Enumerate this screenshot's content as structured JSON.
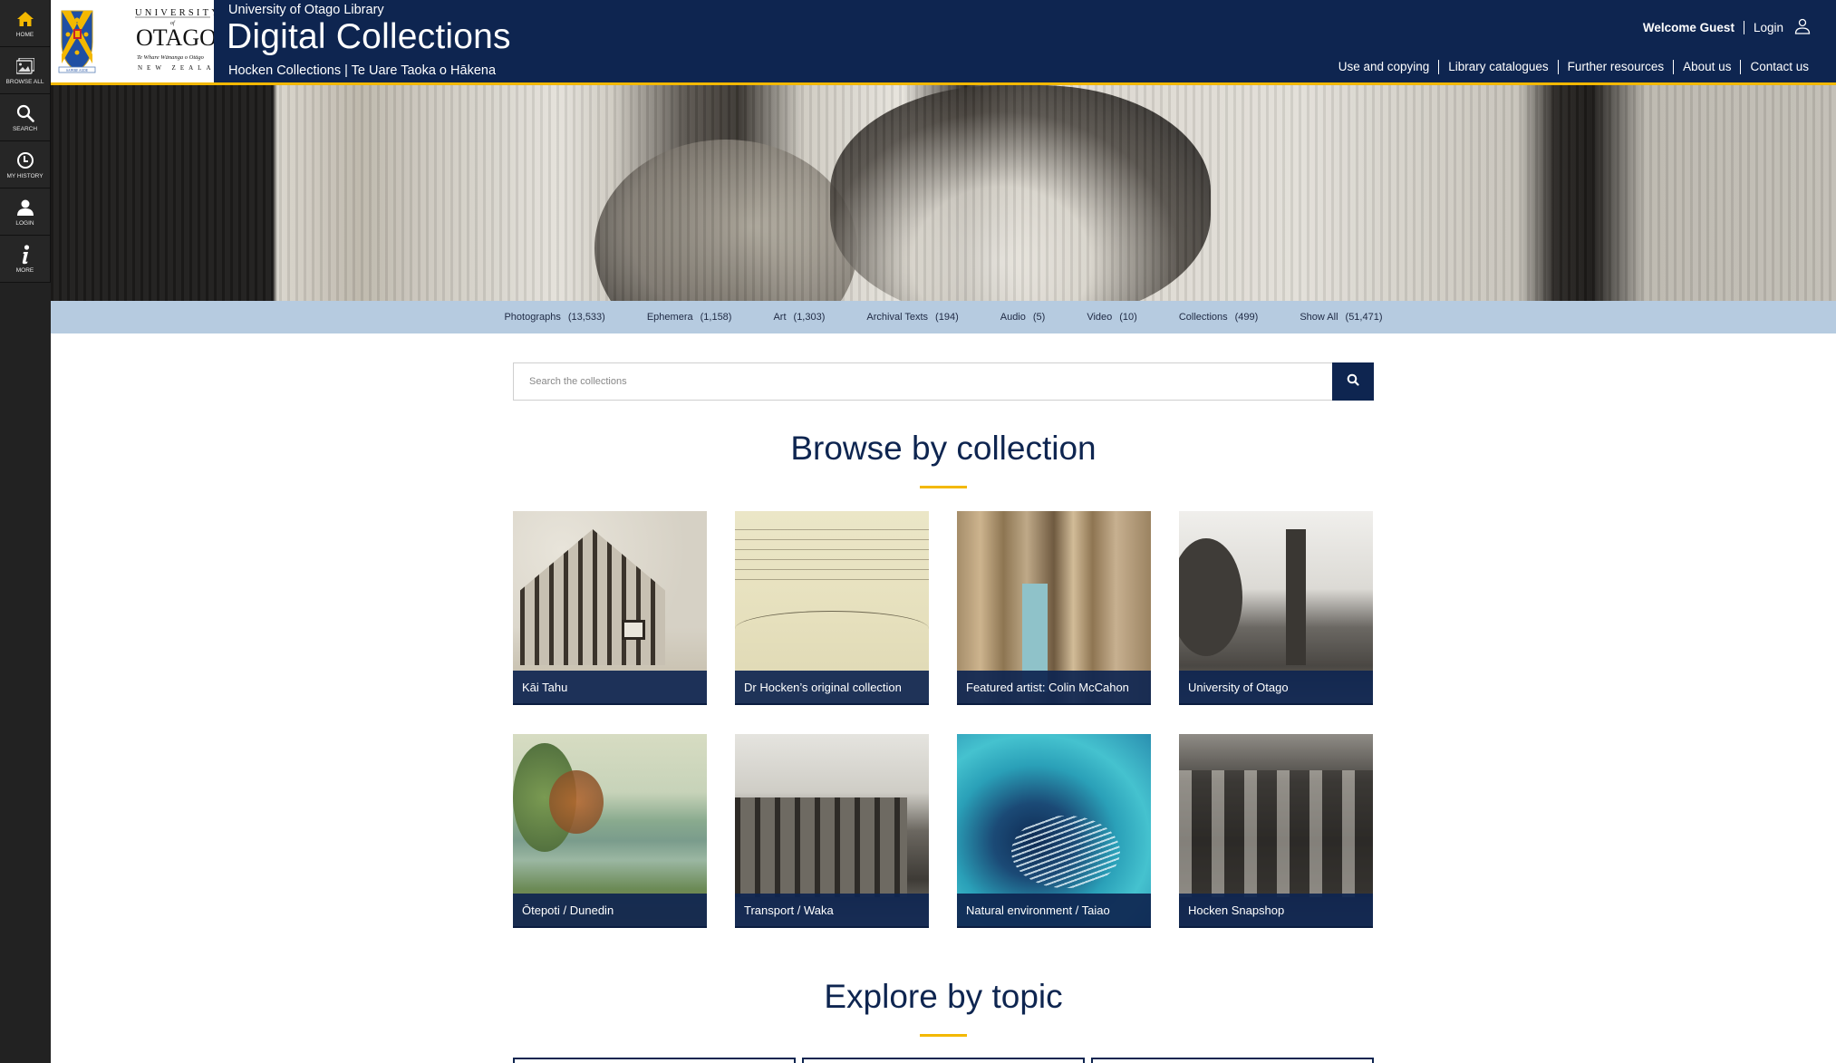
{
  "sidebar": {
    "items": [
      {
        "label": "Home",
        "icon": "home-icon",
        "active": true
      },
      {
        "label": "Browse All",
        "icon": "images-icon"
      },
      {
        "label": "Search",
        "icon": "search-icon"
      },
      {
        "label": "My History",
        "icon": "clock-icon"
      },
      {
        "label": "Login",
        "icon": "user-icon"
      },
      {
        "label": "More",
        "icon": "info-icon"
      }
    ]
  },
  "header": {
    "logo": {
      "line1": "UNIVERSITY",
      "line2": "of",
      "line3": "OTAGO",
      "motto": "Te Whare Wānanga o Otāgo",
      "country": "NEW ZEALAND",
      "crest_motto": "SAPERE AUDE"
    },
    "library_name": "University of Otago Library",
    "title": "Digital Collections",
    "subtitle": "Hocken Collections | Te Uare Taoka o Hākena",
    "welcome": "Welcome Guest",
    "login": "Login",
    "nav": [
      "Use and copying",
      "Library catalogues",
      "Further resources",
      "About us",
      "Contact us"
    ]
  },
  "categories": [
    {
      "label": "Photographs",
      "count": "(13,533)"
    },
    {
      "label": "Ephemera",
      "count": "(1,158)"
    },
    {
      "label": "Art",
      "count": "(1,303)"
    },
    {
      "label": "Archival Texts",
      "count": "(194)"
    },
    {
      "label": "Audio",
      "count": "(5)"
    },
    {
      "label": "Video",
      "count": "(10)"
    },
    {
      "label": "Collections",
      "count": "(499)"
    },
    {
      "label": "Show All",
      "count": "(51,471)"
    }
  ],
  "search": {
    "placeholder": "Search the collections",
    "value": ""
  },
  "browse": {
    "title": "Browse by collection",
    "collections": [
      {
        "label": "Kāi Tahu"
      },
      {
        "label": "Dr Hocken’s original collection"
      },
      {
        "label": "Featured artist: Colin McCahon"
      },
      {
        "label": "University of Otago"
      },
      {
        "label": "Ōtepoti / Dunedin"
      },
      {
        "label": "Transport / Waka"
      },
      {
        "label": "Natural environment / Taiao"
      },
      {
        "label": "Hocken Snapshop"
      }
    ]
  },
  "explore": {
    "title": "Explore by topic"
  },
  "colors": {
    "navy": "#0e2550",
    "gold": "#f3b800",
    "category_bar": "#b6cbe0",
    "sidebar": "#222222"
  }
}
